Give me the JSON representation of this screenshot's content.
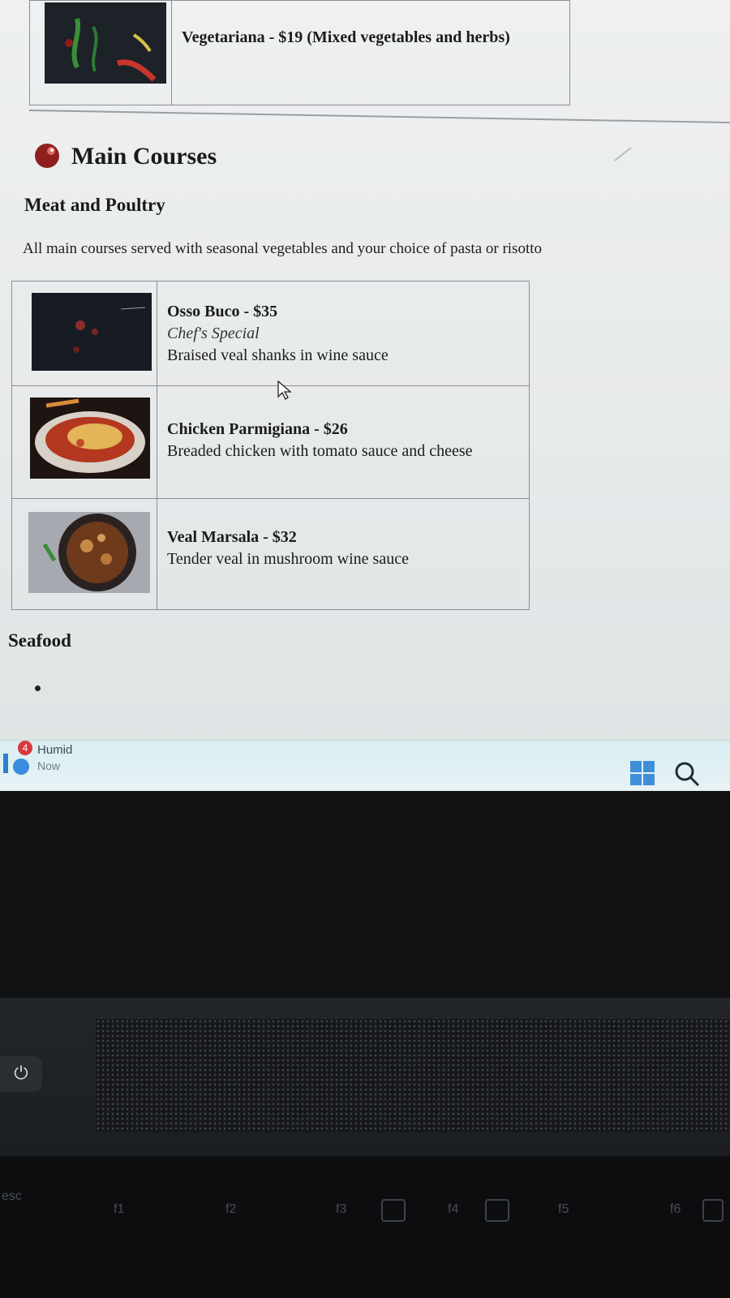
{
  "top_item": {
    "text": "Vegetariana - $19 (Mixed vegetables and herbs)"
  },
  "main_courses": {
    "title": "Main Courses",
    "meat_heading": "Meat and Poultry",
    "intro": "All main courses served with seasonal vegetables and your choice of pasta or risotto",
    "items": [
      {
        "name": "Osso Buco - $35",
        "special": "Chef's Special",
        "desc": "Braised veal shanks in wine sauce"
      },
      {
        "name": "Chicken Parmigiana - $26",
        "desc": "Breaded chicken with tomato sauce and cheese"
      },
      {
        "name": "Veal Marsala - $32",
        "desc": "Tender veal in mushroom wine sauce"
      }
    ],
    "seafood_heading": "Seafood"
  },
  "taskbar": {
    "weather_badge": "4",
    "weather_condition": "Humid",
    "weather_time": "Now",
    "icons": [
      "weather-icon",
      "windows-start-icon",
      "search-icon"
    ]
  },
  "keyboard": {
    "power_icon": "power-icon",
    "keys": [
      "esc",
      "f1",
      "f2",
      "f3",
      "f4",
      "f5",
      "f6"
    ]
  }
}
